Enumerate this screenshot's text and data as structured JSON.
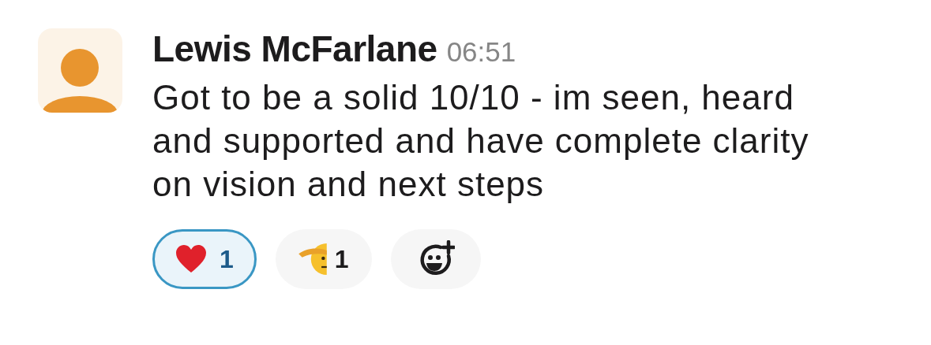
{
  "message": {
    "author": "Lewis McFarlane",
    "time": "06:51",
    "text": "Got to be a solid 10/10 - im seen, heard and supported and have complete clarity on vision and next steps"
  },
  "reactions": [
    {
      "kind": "heart",
      "count": "1",
      "selected": true
    },
    {
      "kind": "salute",
      "count": "1",
      "selected": false
    }
  ]
}
